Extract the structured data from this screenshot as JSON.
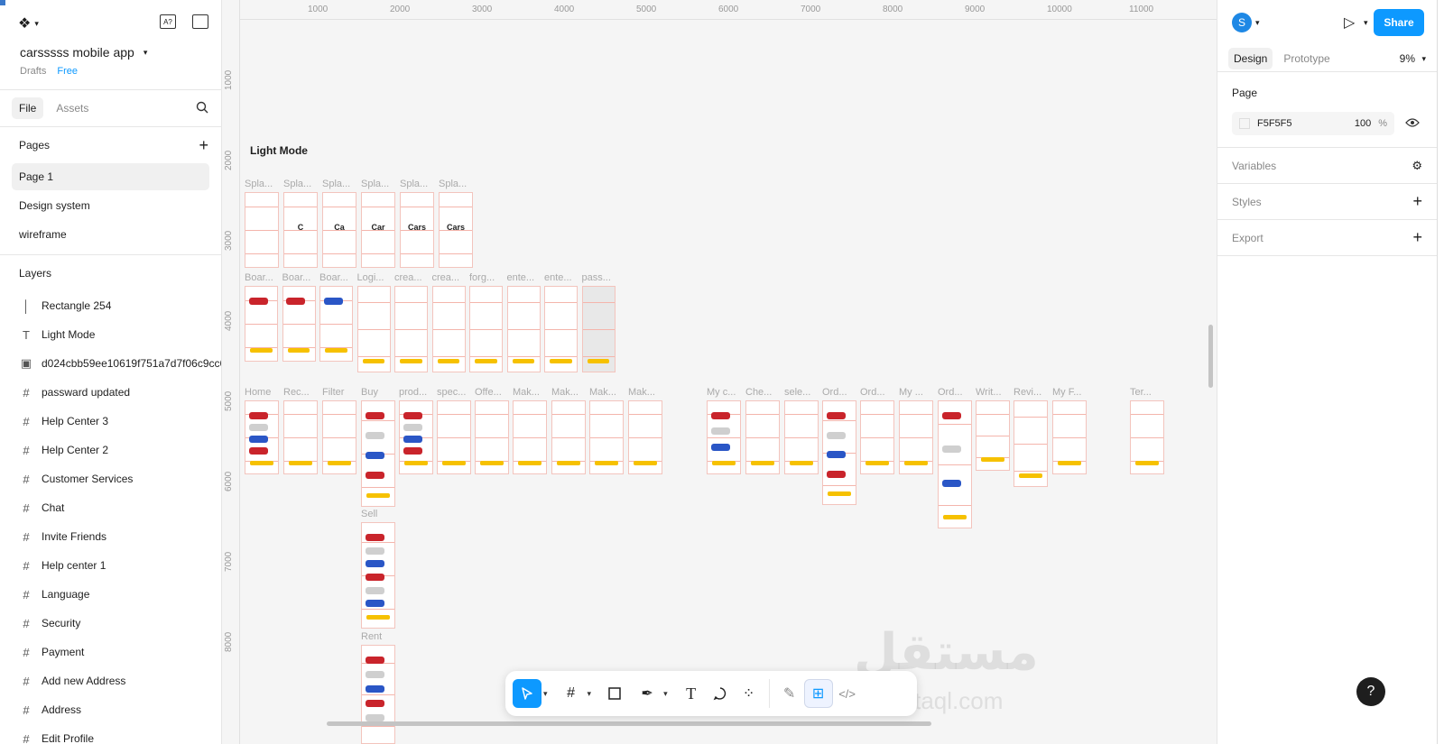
{
  "sidebar": {
    "file_name": "carsssss mobile app",
    "drafts_label": "Drafts",
    "plan_label": "Free",
    "tabs": [
      {
        "label": "File"
      },
      {
        "label": "Assets"
      }
    ],
    "pages_title": "Pages",
    "pages": [
      {
        "label": "Page 1"
      },
      {
        "label": "Design system"
      },
      {
        "label": "wireframe"
      }
    ],
    "layers_title": "Layers",
    "layers": [
      {
        "icon": "rectangle-icon",
        "label": "Rectangle 254"
      },
      {
        "icon": "text-icon",
        "label": "Light Mode"
      },
      {
        "icon": "image-icon",
        "label": "d024cbb59ee10619f751a7d7f06c9cc6"
      },
      {
        "icon": "frame-icon",
        "label": "passward updated"
      },
      {
        "icon": "frame-icon",
        "label": "Help Center 3"
      },
      {
        "icon": "frame-icon",
        "label": "Help Center 2"
      },
      {
        "icon": "frame-icon",
        "label": "Customer Services"
      },
      {
        "icon": "frame-icon",
        "label": "Chat"
      },
      {
        "icon": "frame-icon",
        "label": "Invite Friends"
      },
      {
        "icon": "frame-icon",
        "label": "Help center 1"
      },
      {
        "icon": "frame-icon",
        "label": "Language"
      },
      {
        "icon": "frame-icon",
        "label": "Security"
      },
      {
        "icon": "frame-icon",
        "label": "Payment"
      },
      {
        "icon": "frame-icon",
        "label": "Add new Address"
      },
      {
        "icon": "frame-icon",
        "label": "Address"
      },
      {
        "icon": "frame-icon",
        "label": "Edit Profile"
      }
    ]
  },
  "canvas": {
    "ruler_top": [
      "1000",
      "2000",
      "3000",
      "4000",
      "5000",
      "6000",
      "7000",
      "8000",
      "9000",
      "10000",
      "11000"
    ],
    "ruler_left": [
      "1000",
      "2000",
      "3000",
      "4000",
      "5000",
      "6000",
      "7000",
      "8000"
    ],
    "section_title": "Light Mode",
    "row1_labels": [
      "Spla...",
      "Spla...",
      "Spla...",
      "Spla...",
      "Spla...",
      "Spla..."
    ],
    "splash_letters": [
      "",
      "C",
      "Ca",
      "Car",
      "Cars",
      "Cars"
    ],
    "row2_labels": [
      "Boar...",
      "Boar...",
      "Boar...",
      "Logi...",
      "crea...",
      "crea...",
      "forg...",
      "ente...",
      "ente...",
      "pass..."
    ],
    "row3_labels": [
      "Home",
      "Rec...",
      "Filter",
      "Buy",
      "prod...",
      "spec...",
      "Offe...",
      "Mak...",
      "Mak...",
      "Mak...",
      "Mak...",
      "My c...",
      "Che...",
      "sele...",
      "Ord...",
      "Ord...",
      "My ...",
      "Ord...",
      "Writ...",
      "Revi...",
      "My F...",
      "Ter..."
    ],
    "sell_label": "Sell",
    "rent_label": "Rent",
    "watermark": "مستقل",
    "watermark_sub": "mostaql.com"
  },
  "toolbar": {
    "tools": [
      "move-tool",
      "frame-tool",
      "shape-tool",
      "pen-tool",
      "text-tool",
      "comment-tool",
      "actions-tool"
    ],
    "modes": [
      "draw-mode",
      "design-mode",
      "dev-mode"
    ]
  },
  "right_panel": {
    "avatar_letter": "S",
    "share_label": "Share",
    "tabs": [
      {
        "label": "Design"
      },
      {
        "label": "Prototype"
      }
    ],
    "zoom": "9%",
    "page_title": "Page",
    "page_color": "F5F5F5",
    "page_opacity": "100",
    "page_opacity_unit": "%",
    "sections": [
      {
        "label": "Variables"
      },
      {
        "label": "Styles"
      },
      {
        "label": "Export"
      }
    ]
  },
  "help_label": "?",
  "colors": {
    "accent": "#0d99ff",
    "highlight": "#f6c100",
    "guide": "#f4b5ac"
  }
}
